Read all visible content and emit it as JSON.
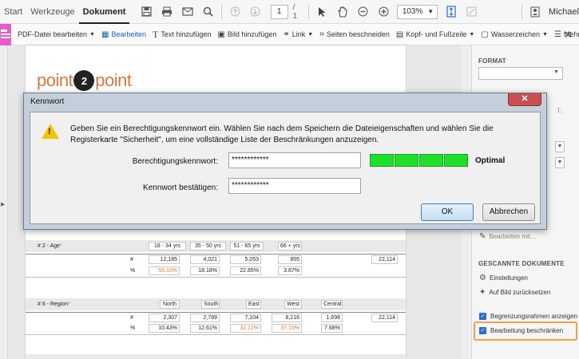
{
  "menubar": {
    "tabs": [
      "Start",
      "Werkzeuge",
      "Dokument"
    ],
    "active_tab": "Dokument",
    "page_current": "1",
    "page_total": "/ 1",
    "zoom": "103%",
    "user": "Michael"
  },
  "editbar": {
    "title": "PDF-Datei bearbeiten",
    "items": [
      {
        "label": "Bearbeiten",
        "icon": "edit-cursor-icon"
      },
      {
        "label": "Text hinzufügen",
        "icon": "text-icon"
      },
      {
        "label": "Bild hinzufügen",
        "icon": "image-icon"
      },
      {
        "label": "Link",
        "icon": "link-icon"
      },
      {
        "label": "Seiten beschneiden",
        "icon": "crop-icon"
      },
      {
        "label": "Kopf- und Fußzeile",
        "icon": "header-footer-icon"
      },
      {
        "label": "Wasserzeichen",
        "icon": "watermark-icon"
      },
      {
        "label": "Mehr",
        "icon": "more-icon"
      }
    ]
  },
  "logo": {
    "left": "point",
    "mid": "2",
    "right": "point"
  },
  "table_age": {
    "label": "# 2 - Age",
    "headers": [
      "18 - 34 yrs",
      "35 - 50 yrs",
      "51 - 65 yrs",
      "66 + yrs"
    ],
    "count_symbol": "#",
    "pct_symbol": "%",
    "counts": [
      "12,185",
      "4,021",
      "5,053",
      "855"
    ],
    "total": "22,114",
    "pcts": [
      "55.10%",
      "18.18%",
      "22.85%",
      "3.87%"
    ]
  },
  "table_region": {
    "label": "# 6 - Region",
    "headers": [
      "North",
      "South",
      "East",
      "West",
      "Central"
    ],
    "count_symbol": "#",
    "pct_symbol": "%",
    "counts": [
      "2,307",
      "2,789",
      "7,104",
      "8,216",
      "1,698"
    ],
    "total": "22,114",
    "pcts": [
      "10.43%",
      "12.61%",
      "32.12%",
      "37.15%",
      "7.68%"
    ]
  },
  "rightpanel": {
    "format_head": "FORMAT",
    "edit_more": "Bearbeiten mit...",
    "scan_head": "GESCANNTE DOKUMENTE",
    "settings": "Einstellungen",
    "reset": "Auf Bild zurücksetzen",
    "bounding": "Begrenzungsrahmen anzeigen",
    "restrict": "Bearbeitung beschränken",
    "t_sub": "T₁"
  },
  "dialog": {
    "title": "Kennwort",
    "close": "✕",
    "message": "Geben Sie ein Berechtigungskennwort ein. Wählen Sie nach dem Speichern die Dateieigenschaften und wählen Sie die Registerkarte \"Sicherheit\", um eine vollständige Liste der Beschränkungen anzuzeigen.",
    "perm_label": "Berechtigungskennwort:",
    "perm_value": "************",
    "confirm_label": "Kennwort bestätigen:",
    "confirm_value": "************",
    "strength": "Optimal",
    "strength_level": 1.0,
    "ok": "OK",
    "cancel": "Abbrechen"
  }
}
